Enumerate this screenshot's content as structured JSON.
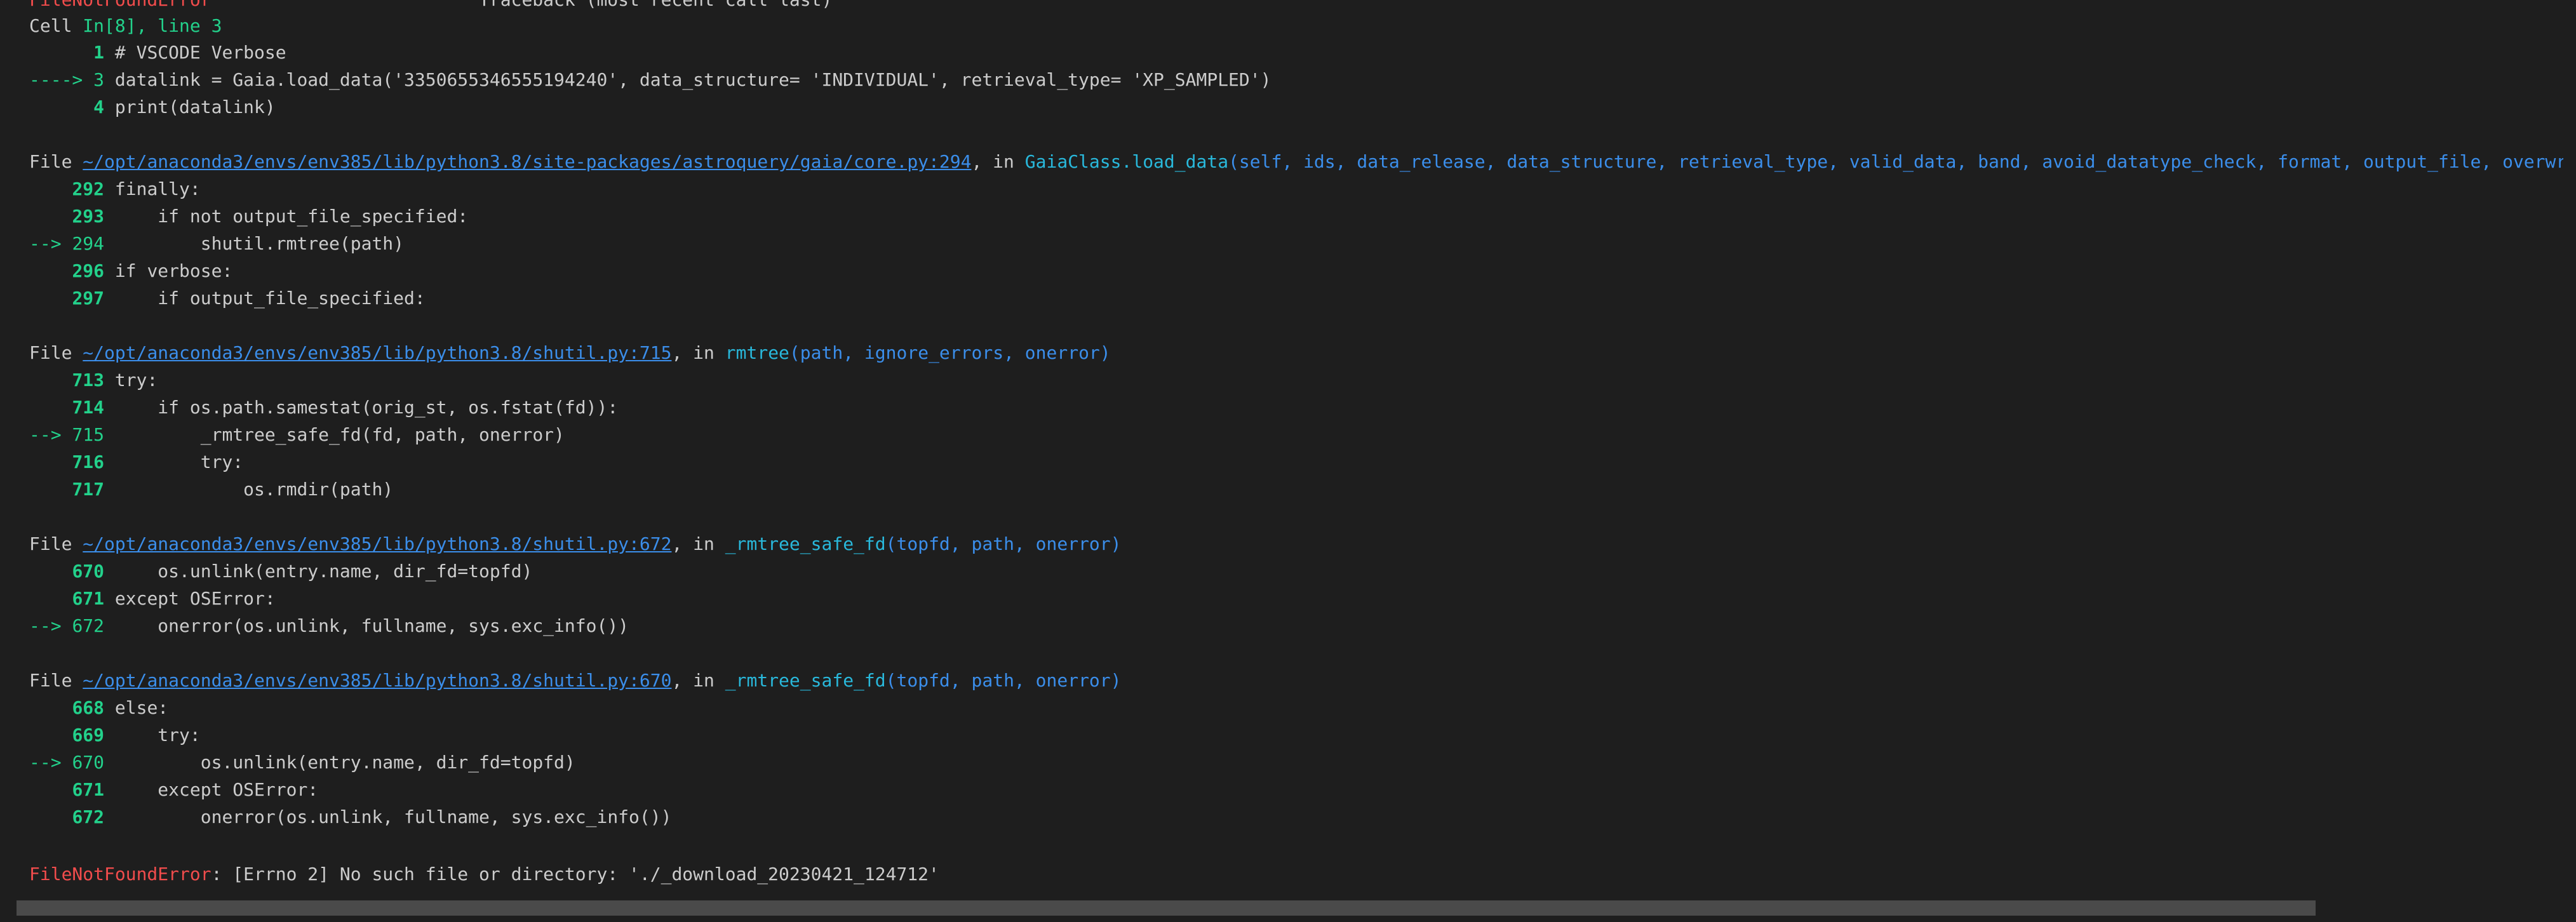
{
  "colors": {
    "background": "#1e1e1e",
    "text": "#cccccc",
    "error_red": "#f14c4c",
    "line_green": "#23d18b",
    "link_blue": "#3b8eea",
    "func_cyan": "#29b8db",
    "scrollbar": "#4a4a4a"
  },
  "header": {
    "error_name_cut": "FileNotFoundError",
    "traceback_cut": "Traceback (most recent call last)"
  },
  "cell": {
    "label": "Cell ",
    "ref": "In[8], line 3",
    "lines": [
      {
        "marker": "      ",
        "num": "1",
        "code": " # VSCODE Verbose"
      },
      {
        "marker": "----> ",
        "num": "3",
        "code": " datalink = Gaia.load_data('3350655346555194240', data_structure= 'INDIVIDUAL', retrieval_type= 'XP_SAMPLED')"
      },
      {
        "marker": "      ",
        "num": "4",
        "code": " print(datalink)"
      }
    ]
  },
  "frames": [
    {
      "file_prefix": "File ",
      "path": "~/opt/anaconda3/envs/env385/lib/python3.8/site-packages/astroquery/gaia/core.py:294",
      "in_text": ", in ",
      "func": "GaiaClass.load_data",
      "args": "(self, ids, data_release, data_structure, retrieval_type, valid_data, band, avoid_datatype_check, format, output_file, overwrite_output_file, verbose)",
      "lines": [
        {
          "marker": "    ",
          "num": "292",
          "code": " finally:"
        },
        {
          "marker": "    ",
          "num": "293",
          "code": "     if not output_file_specified:"
        },
        {
          "marker": "--> ",
          "num": "294",
          "code": "         shutil.rmtree(path)"
        },
        {
          "marker": "    ",
          "num": "296",
          "code": " if verbose:"
        },
        {
          "marker": "    ",
          "num": "297",
          "code": "     if output_file_specified:"
        }
      ]
    },
    {
      "file_prefix": "File ",
      "path": "~/opt/anaconda3/envs/env385/lib/python3.8/shutil.py:715",
      "in_text": ", in ",
      "func": "rmtree",
      "args": "(path, ignore_errors, onerror)",
      "lines": [
        {
          "marker": "    ",
          "num": "713",
          "code": " try:"
        },
        {
          "marker": "    ",
          "num": "714",
          "code": "     if os.path.samestat(orig_st, os.fstat(fd)):"
        },
        {
          "marker": "--> ",
          "num": "715",
          "code": "         _rmtree_safe_fd(fd, path, onerror)"
        },
        {
          "marker": "    ",
          "num": "716",
          "code": "         try:"
        },
        {
          "marker": "    ",
          "num": "717",
          "code": "             os.rmdir(path)"
        }
      ]
    },
    {
      "file_prefix": "File ",
      "path": "~/opt/anaconda3/envs/env385/lib/python3.8/shutil.py:672",
      "in_text": ", in ",
      "func": "_rmtree_safe_fd",
      "args": "(topfd, path, onerror)",
      "lines": [
        {
          "marker": "    ",
          "num": "670",
          "code": "     os.unlink(entry.name, dir_fd=topfd)"
        },
        {
          "marker": "    ",
          "num": "671",
          "code": " except OSError:"
        },
        {
          "marker": "--> ",
          "num": "672",
          "code": "     onerror(os.unlink, fullname, sys.exc_info())"
        }
      ]
    },
    {
      "file_prefix": "File ",
      "path": "~/opt/anaconda3/envs/env385/lib/python3.8/shutil.py:670",
      "in_text": ", in ",
      "func": "_rmtree_safe_fd",
      "args": "(topfd, path, onerror)",
      "lines": [
        {
          "marker": "    ",
          "num": "668",
          "code": " else:"
        },
        {
          "marker": "    ",
          "num": "669",
          "code": "     try:"
        },
        {
          "marker": "--> ",
          "num": "670",
          "code": "         os.unlink(entry.name, dir_fd=topfd)"
        },
        {
          "marker": "    ",
          "num": "671",
          "code": "     except OSError:"
        },
        {
          "marker": "    ",
          "num": "672",
          "code": "         onerror(os.unlink, fullname, sys.exc_info())"
        }
      ]
    }
  ],
  "final_error": {
    "name": "FileNotFoundError",
    "message": ": [Errno 2] No such file or directory: './_download_20230421_124712'"
  }
}
